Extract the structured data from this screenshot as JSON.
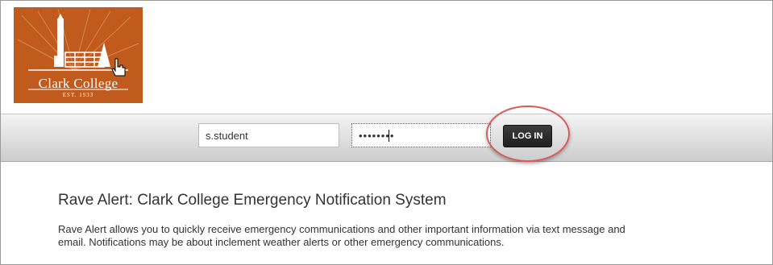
{
  "logo": {
    "name": "Clark College",
    "established": "EST. 1933",
    "color": "#c05a1d"
  },
  "login": {
    "username_value": "s.student",
    "password_value": "••••••••",
    "button_label": "LOG IN"
  },
  "content": {
    "title": "Rave Alert: Clark College Emergency Notification System",
    "description": "Rave Alert allows you to quickly receive emergency communications and other important information via text message and email.  Notifications may be about inclement weather alerts or other emergency communications."
  },
  "annotation": {
    "highlight_color": "#de5a5a"
  }
}
